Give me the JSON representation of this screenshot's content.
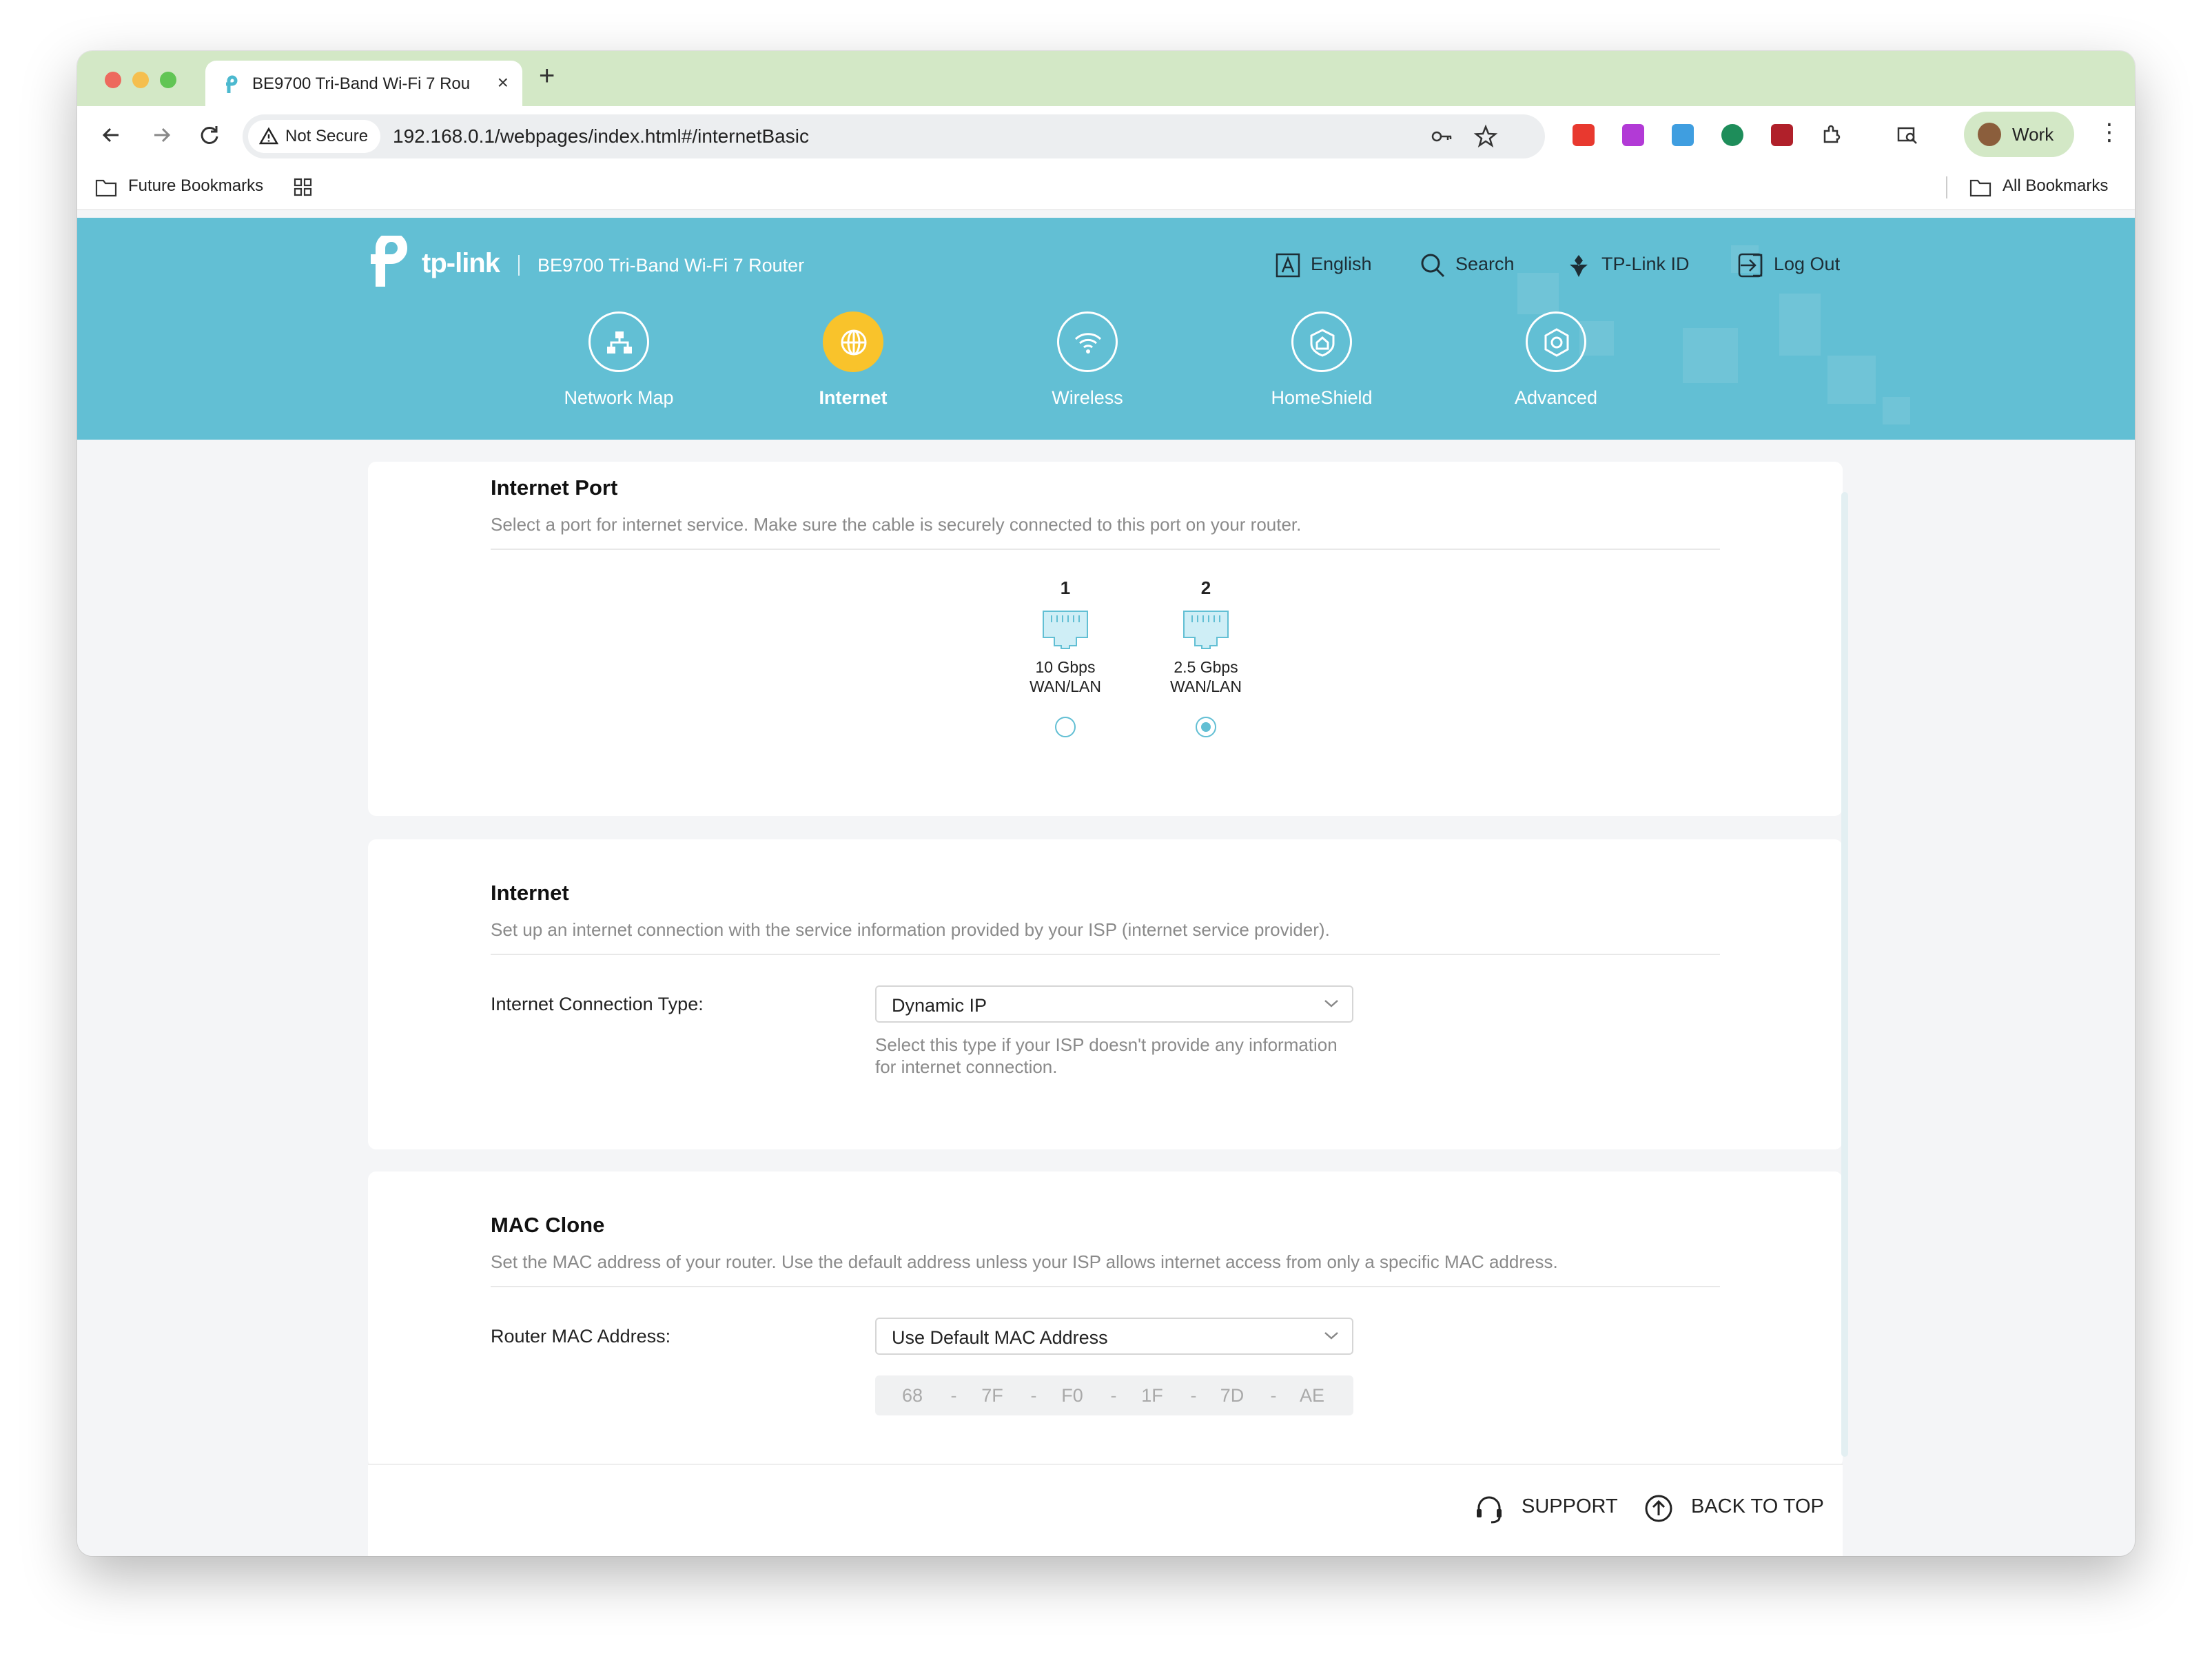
{
  "browser": {
    "tab_title": "BE9700 Tri-Band Wi-Fi 7 Rou",
    "tab_close": "×",
    "new_tab": "+",
    "security_label": "Not Secure",
    "url": "192.168.0.1/webpages/index.html#/internetBasic",
    "profile_label": "Work",
    "menu": "⋮",
    "bookmarks": {
      "left": "Future Bookmarks",
      "right": "All Bookmarks"
    }
  },
  "header": {
    "logo_text": "tp-link",
    "model": "BE9700 Tri-Band Wi-Fi 7 Router",
    "links": {
      "language": "English",
      "search": "Search",
      "tplink_id": "TP-Link ID",
      "logout": "Log Out"
    },
    "nav": [
      {
        "label": "Network Map",
        "icon": "network-map-icon"
      },
      {
        "label": "Internet",
        "icon": "globe-icon",
        "active": true
      },
      {
        "label": "Wireless",
        "icon": "wifi-icon"
      },
      {
        "label": "HomeShield",
        "icon": "homeshield-icon"
      },
      {
        "label": "Advanced",
        "icon": "advanced-gear-icon"
      }
    ],
    "colors": {
      "header_bg": "#62bfd4",
      "active": "#f9c32b"
    }
  },
  "internet_port": {
    "title": "Internet Port",
    "description": "Select a port for internet service. Make sure the cable is securely connected to this port on your router.",
    "ports": [
      {
        "number": "1",
        "speed": "10 Gbps",
        "type": "WAN/LAN",
        "selected": false
      },
      {
        "number": "2",
        "speed": "2.5 Gbps",
        "type": "WAN/LAN",
        "selected": true
      }
    ]
  },
  "internet": {
    "title": "Internet",
    "description": "Set up an internet connection with the service information provided by your ISP (internet service provider).",
    "connection_type_label": "Internet Connection Type:",
    "connection_type_value": "Dynamic IP",
    "connection_type_hint": "Select this type if your ISP doesn't provide any information for internet connection."
  },
  "mac_clone": {
    "title": "MAC Clone",
    "description": "Set the MAC address of your router. Use the default address unless your ISP allows internet access from only a specific MAC address.",
    "router_mac_label": "Router MAC Address:",
    "router_mac_value": "Use Default MAC Address",
    "mac_segments": [
      "68",
      "7F",
      "F0",
      "1F",
      "7D",
      "AE"
    ],
    "separator": "-"
  },
  "footer": {
    "support": "SUPPORT",
    "back_to_top": "BACK TO TOP"
  }
}
